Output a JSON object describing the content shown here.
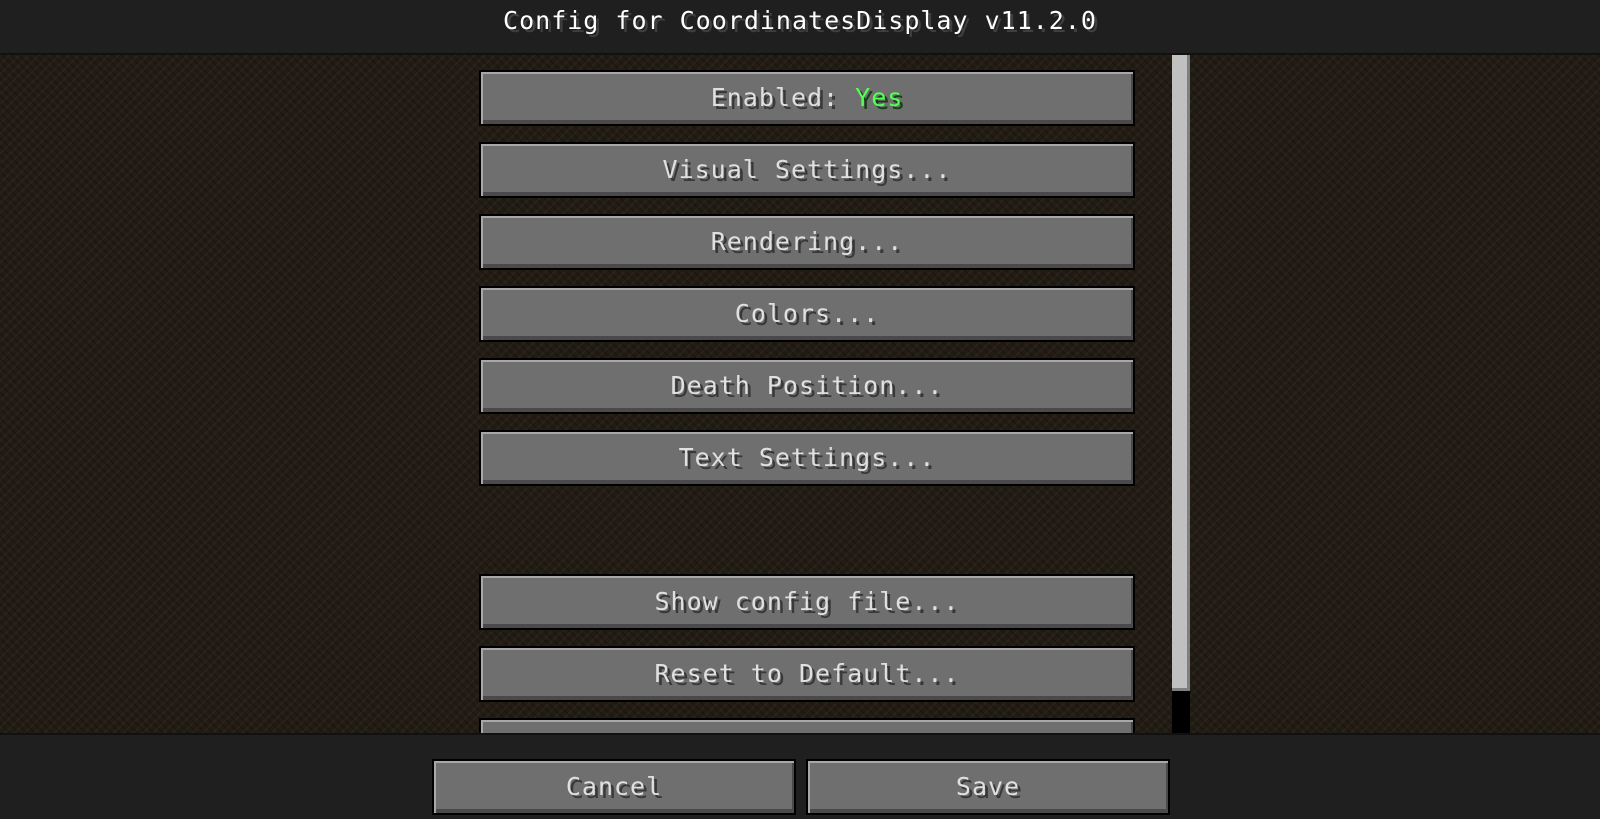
{
  "header": {
    "title": "Config for CoordinatesDisplay v11.2.0"
  },
  "list": {
    "enabled": {
      "label": "Enabled: ",
      "value": "Yes"
    },
    "items": [
      "Visual Settings...",
      "Rendering...",
      "Colors...",
      "Death Position...",
      "Text Settings..."
    ],
    "actions": [
      "Show config file...",
      "Reset to Default..."
    ]
  },
  "footer": {
    "cancel_label": "Cancel",
    "save_label": "Save"
  },
  "colors": {
    "value_on": "#55ff55",
    "button": "#6f6f6f",
    "scrollbar_thumb": "#c0c0c0"
  }
}
